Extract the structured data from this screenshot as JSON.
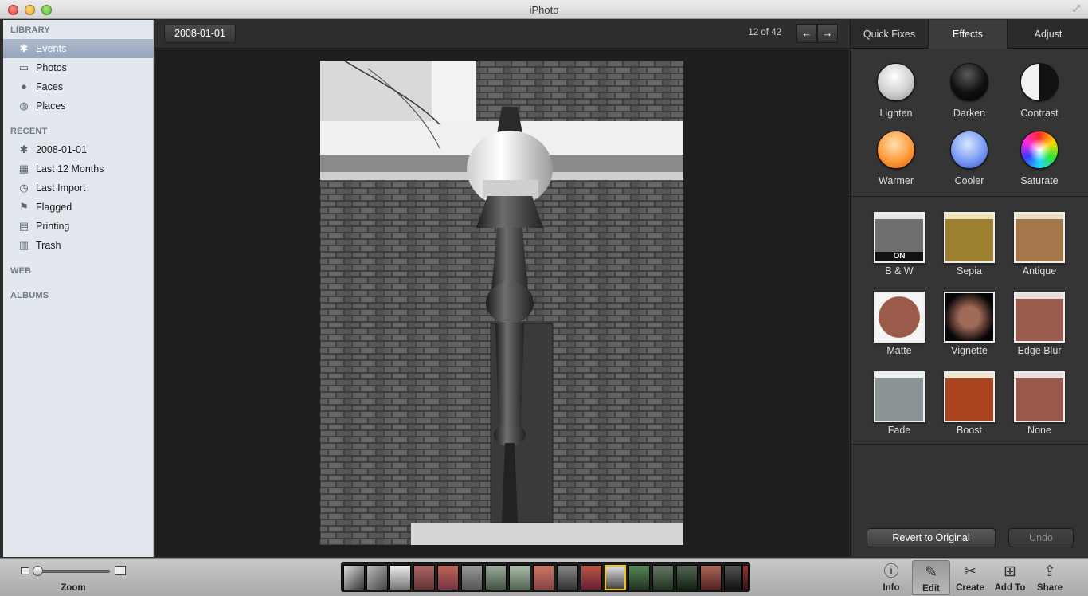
{
  "window": {
    "title": "iPhoto"
  },
  "sidebar": {
    "sections": {
      "library": "LIBRARY",
      "recent": "RECENT",
      "web": "WEB",
      "albums": "ALBUMS"
    },
    "library_items": [
      {
        "label": "Events",
        "icon": "palm-tree-icon",
        "selected": true
      },
      {
        "label": "Photos",
        "icon": "photos-icon"
      },
      {
        "label": "Faces",
        "icon": "person-icon"
      },
      {
        "label": "Places",
        "icon": "globe-icon"
      }
    ],
    "recent_items": [
      {
        "label": "2008-01-01",
        "icon": "palm-tree-icon"
      },
      {
        "label": "Last 12 Months",
        "icon": "calendar-icon"
      },
      {
        "label": "Last Import",
        "icon": "clock-icon"
      },
      {
        "label": "Flagged",
        "icon": "flag-icon"
      },
      {
        "label": "Printing",
        "icon": "printer-icon"
      },
      {
        "label": "Trash",
        "icon": "trash-icon"
      }
    ]
  },
  "viewer": {
    "breadcrumb": "2008-01-01",
    "counter": "12 of 42",
    "prev": "←",
    "next": "→"
  },
  "panel": {
    "tabs": [
      "Quick Fixes",
      "Effects",
      "Adjust"
    ],
    "active_tab": "Effects",
    "quick_effects": [
      "Lighten",
      "Darken",
      "Contrast",
      "Warmer",
      "Cooler",
      "Saturate"
    ],
    "effects": [
      "B & W",
      "Sepia",
      "Antique",
      "Matte",
      "Vignette",
      "Edge Blur",
      "Fade",
      "Boost",
      "None"
    ],
    "on_badge": "ON",
    "revert_label": "Revert to Original",
    "undo_label": "Undo"
  },
  "toolbar": {
    "zoom_label": "Zoom",
    "tools": [
      {
        "label": "Info",
        "icon": "info-icon"
      },
      {
        "label": "Edit",
        "icon": "pencil-icon",
        "active": true
      },
      {
        "label": "Create",
        "icon": "scissors-icon"
      },
      {
        "label": "Add To",
        "icon": "plus-icon"
      },
      {
        "label": "Share",
        "icon": "share-icon"
      }
    ]
  },
  "filmstrip": {
    "current_index": 11,
    "count": 18
  }
}
